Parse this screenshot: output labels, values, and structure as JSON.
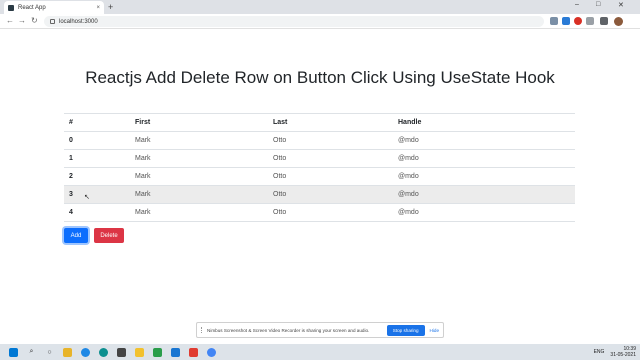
{
  "browser": {
    "tab_title": "React App",
    "tab_close": "×",
    "new_tab": "+",
    "url": "localhost:3000",
    "back_glyph": "←",
    "forward_glyph": "→",
    "reload_glyph": "↻",
    "minimize_glyph": "–",
    "maximize_glyph": "□",
    "close_glyph": "✕"
  },
  "page": {
    "title": "Reactjs Add Delete Row on Button Click Using UseState Hook"
  },
  "table": {
    "headers": [
      "#",
      "First",
      "Last",
      "Handle"
    ],
    "rows": [
      [
        "0",
        "Mark",
        "Otto",
        "@mdo"
      ],
      [
        "1",
        "Mark",
        "Otto",
        "@mdo"
      ],
      [
        "2",
        "Mark",
        "Otto",
        "@mdo"
      ],
      [
        "3",
        "Mark",
        "Otto",
        "@mdo"
      ],
      [
        "4",
        "Mark",
        "Otto",
        "@mdo"
      ]
    ]
  },
  "buttons": {
    "add_label": "Add",
    "delete_label": "Delete"
  },
  "share_bar": {
    "message": "Nimbus Screenshot & Screen Video Recorder is sharing your screen and audio.",
    "stop_label": "Stop sharing",
    "hide_label": "Hide"
  },
  "taskbar": {
    "language": "ENG",
    "time": "10:39",
    "date": "31-05-2021"
  },
  "colors": {
    "primary": "#0d6efd",
    "danger": "#dc3545",
    "hover_row": "#ececec"
  }
}
